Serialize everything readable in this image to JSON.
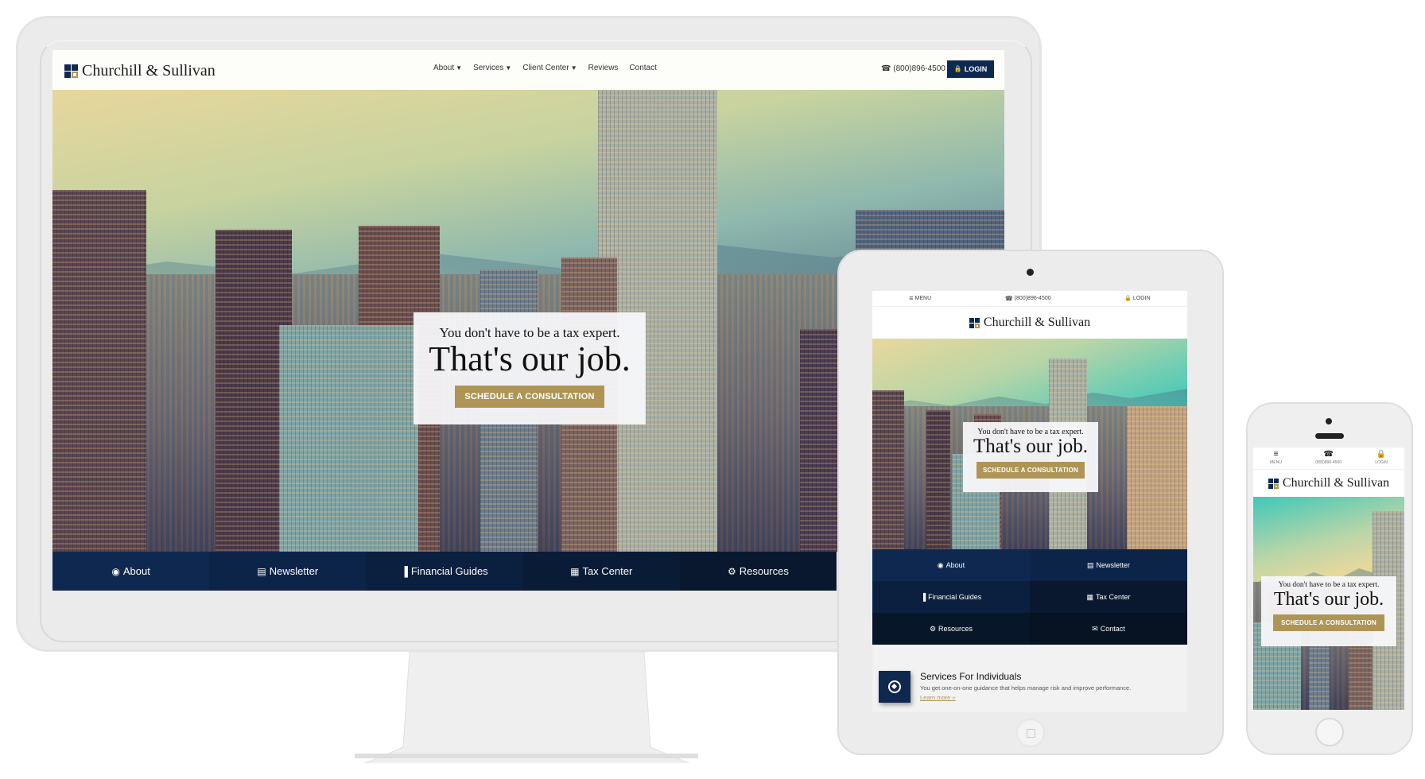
{
  "brand": {
    "name": "Churchill & Sullivan",
    "colors": {
      "navy": "#0f2850",
      "gold": "#ae9556",
      "frame": "#ebebeb"
    }
  },
  "desktop": {
    "nav": [
      {
        "label": "About",
        "has_dropdown": true
      },
      {
        "label": "Services",
        "has_dropdown": true
      },
      {
        "label": "Client Center",
        "has_dropdown": true
      },
      {
        "label": "Reviews",
        "has_dropdown": false
      },
      {
        "label": "Contact",
        "has_dropdown": false
      }
    ],
    "phone": "(800)896-4500",
    "login_label": "LOGIN",
    "hero": {
      "subtitle": "You don't have to be a tax expert.",
      "headline": "That's our job.",
      "cta_label": "SCHEDULE A CONSULTATION"
    },
    "quick_links": [
      {
        "label": "About",
        "icon": "user-circle-icon",
        "glyph": "◉"
      },
      {
        "label": "Newsletter",
        "icon": "newspaper-icon",
        "glyph": "▤"
      },
      {
        "label": "Financial Guides",
        "icon": "bar-chart-icon",
        "glyph": "▐"
      },
      {
        "label": "Tax Center",
        "icon": "calendar-icon",
        "glyph": "▦"
      },
      {
        "label": "Resources",
        "icon": "gear-icon",
        "glyph": "⚙"
      }
    ]
  },
  "tablet": {
    "top_bar": {
      "menu_label": "MENU",
      "phone": "(800)896-4500",
      "login_label": "LOGIN"
    },
    "hero": {
      "subtitle": "You don't have to be a tax expert.",
      "headline": "That's our job.",
      "cta_label": "SCHEDULE A CONSULTATION"
    },
    "quick_links": [
      {
        "label": "About",
        "icon": "user-circle-icon",
        "glyph": "◉"
      },
      {
        "label": "Newsletter",
        "icon": "newspaper-icon",
        "glyph": "▤"
      },
      {
        "label": "Financial Guides",
        "icon": "bar-chart-icon",
        "glyph": "▐"
      },
      {
        "label": "Tax Center",
        "icon": "calendar-icon",
        "glyph": "▦"
      },
      {
        "label": "Resources",
        "icon": "gear-icon",
        "glyph": "⚙"
      },
      {
        "label": "Contact",
        "icon": "chat-icon",
        "glyph": "✉"
      }
    ],
    "service": {
      "title": "Services For Individuals",
      "description": "You get one-on-one guidance that helps manage risk and improve performance.",
      "link_label": "Learn more »"
    }
  },
  "phone": {
    "top_bar": {
      "menu_label": "MENU",
      "phone": "(800)896-4500",
      "login_label": "LOGIN"
    },
    "hero": {
      "subtitle": "You don't have to be a tax expert.",
      "headline": "That's our job.",
      "cta_label": "SCHEDULE A CONSULTATION"
    }
  },
  "icons": {
    "menu": "≡",
    "phone": "☎",
    "lock": "🔒",
    "caret": "▼"
  }
}
